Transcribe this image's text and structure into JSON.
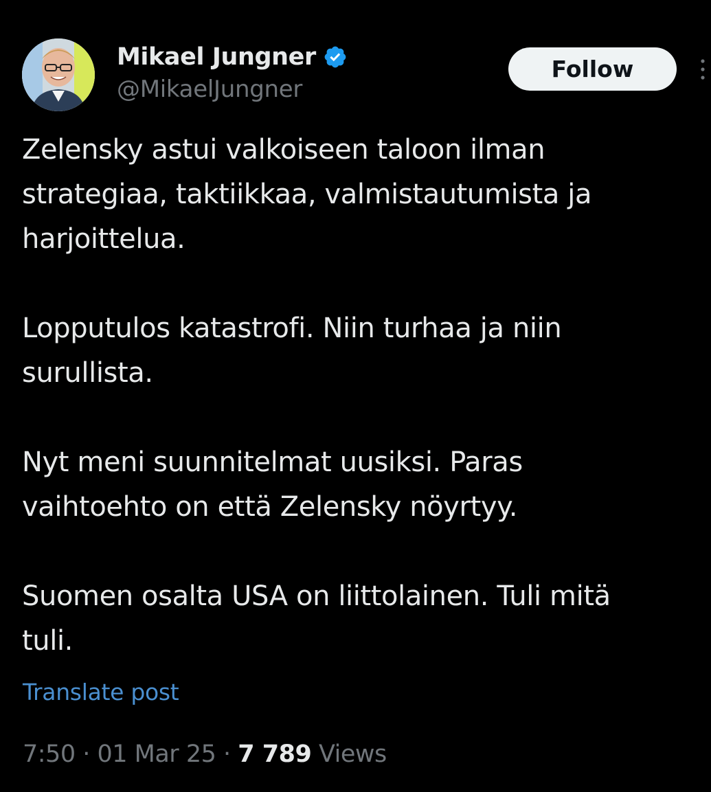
{
  "author": {
    "display_name": "Mikael Jungner",
    "handle": "@MikaelJungner",
    "verified_badge": "verified-badge-icon",
    "verified_color": "#1d9bf0"
  },
  "actions": {
    "follow_label": "Follow",
    "more_icon": "more-vertical-icon"
  },
  "post": {
    "paragraphs": [
      "Zelensky astui valkoiseen taloon ilman\nstrategiaa, taktiikkaa, valmistautumista ja\nharjoittelua.",
      "Lopputulos katastrofi. Niin turhaa ja niin\nsurullista.",
      "Nyt meni suunnitelmat uusiksi. Paras\nvaihtoehto on että Zelensky nöyrtyy.",
      "Suomen osalta USA on liittolainen. Tuli mitä\ntuli."
    ],
    "translate_label": "Translate post"
  },
  "meta": {
    "time": "7:50",
    "separator": " · ",
    "date": "01 Mar 25",
    "views_count": "7 789",
    "views_label": "Views"
  },
  "colors": {
    "background": "#000000",
    "text_primary": "#e7e9ea",
    "text_secondary": "#71767b",
    "link": "#1d9bf0",
    "follow_bg": "#eff3f4"
  }
}
